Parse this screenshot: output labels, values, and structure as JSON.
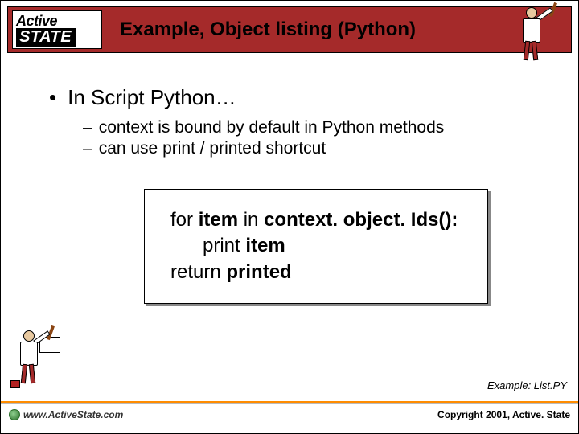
{
  "header": {
    "logo": {
      "line1": "Active",
      "line2": "STATE"
    },
    "title": "Example, Object listing (Python)"
  },
  "content": {
    "bullet": "In Script Python…",
    "subitems": [
      "context is bound by default in Python methods",
      "can use print / printed shortcut"
    ]
  },
  "code": {
    "line1": {
      "kw1": "for",
      "ident1": "item",
      "kw2": "in",
      "ident2": "context. object. Ids():"
    },
    "line2": {
      "kw": "print",
      "ident": "item"
    },
    "line3": {
      "kw": "return",
      "ident": "printed"
    }
  },
  "example_note": "Example: List.PY",
  "footer": {
    "url": "www.ActiveState.com",
    "copyright": "Copyright 2001, Active. State"
  }
}
